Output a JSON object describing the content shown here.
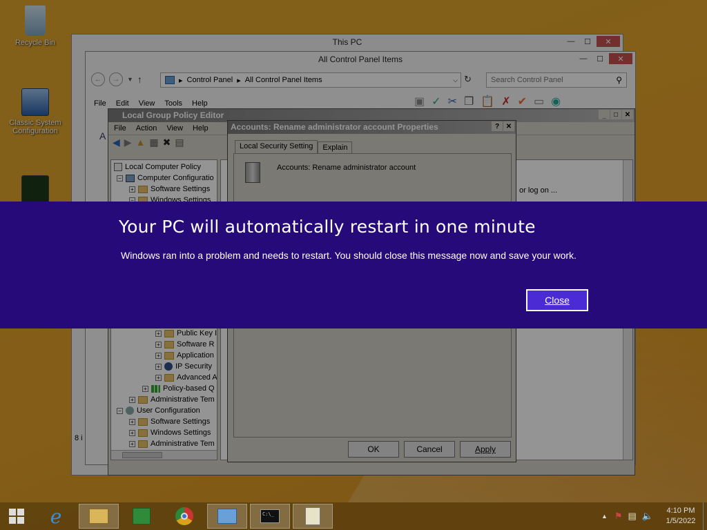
{
  "desktop": {
    "icons": [
      {
        "label": "Recycle Bin"
      },
      {
        "label": "Classic System Configuration"
      }
    ]
  },
  "windows": {
    "this_pc": {
      "title": "This PC"
    },
    "control_panel": {
      "title": "All Control Panel Items",
      "breadcrumb": [
        "Control Panel",
        "All Control Panel Items"
      ],
      "search_placeholder": "Search Control Panel",
      "menu": [
        "File",
        "Edit",
        "View",
        "Tools",
        "Help"
      ],
      "side_text": "A",
      "status_text": "8 i"
    },
    "gpedit": {
      "title": "Local Group Policy Editor",
      "menu": [
        "File",
        "Action",
        "View",
        "Help"
      ],
      "tree": [
        {
          "label": "Local Computer Policy",
          "level": 0
        },
        {
          "label": "Computer Configuratio",
          "level": 1
        },
        {
          "label": "Software Settings",
          "level": 2
        },
        {
          "label": "Windows Settings",
          "level": 2
        }
      ],
      "tree_lower": [
        {
          "label": "Public Key I",
          "level": 4
        },
        {
          "label": "Software R",
          "level": 4
        },
        {
          "label": "Application",
          "level": 4
        },
        {
          "label": "IP Security",
          "level": 4
        },
        {
          "label": "Advanced A",
          "level": 4
        },
        {
          "label": "Policy-based Q",
          "level": 3
        },
        {
          "label": "Administrative Tem",
          "level": 2
        },
        {
          "label": "User Configuration",
          "level": 1
        },
        {
          "label": "Software Settings",
          "level": 2
        },
        {
          "label": "Windows Settings",
          "level": 2
        },
        {
          "label": "Administrative Tem",
          "level": 2
        }
      ],
      "right_text": "or log on ..."
    },
    "properties": {
      "title": "Accounts: Rename administrator account Properties",
      "tabs": [
        "Local Security Setting",
        "Explain"
      ],
      "setting_name": "Accounts: Rename administrator account",
      "buttons": {
        "ok": "OK",
        "cancel": "Cancel",
        "apply": "Apply"
      }
    }
  },
  "restart_banner": {
    "title": "Your PC will automatically restart in one minute",
    "message": "Windows ran into a problem and needs to restart. You should close this message now and save your work.",
    "close_label": "Close",
    "background_color": "#260a7a"
  },
  "taskbar": {
    "apps": [
      "start-button",
      "internet-explorer",
      "file-explorer",
      "store",
      "chrome",
      "control-panel",
      "command-prompt",
      "notepad"
    ],
    "clock": {
      "time": "4:10 PM",
      "date": "1/5/2022"
    }
  }
}
